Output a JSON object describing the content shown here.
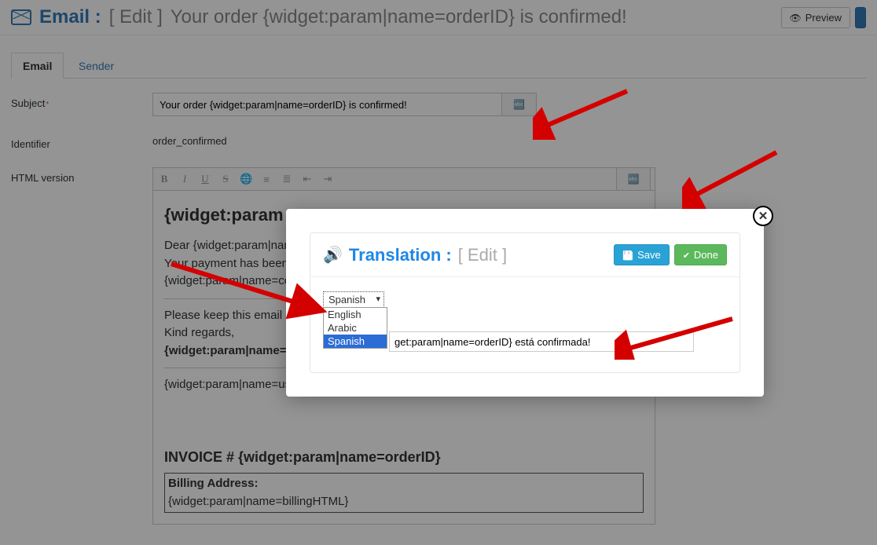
{
  "header": {
    "title_label": "Email :",
    "edit_label": "[ Edit ]",
    "title_rest": "Your order {widget:param|name=orderID} is confirmed!",
    "preview_label": "Preview"
  },
  "tabs": {
    "email": "Email",
    "sender": "Sender"
  },
  "form": {
    "subject_label": "Subject",
    "subject_value": "Your order {widget:param|name=orderID} is confirmed!",
    "identifier_label": "Identifier",
    "identifier_value": "order_confirmed",
    "html_label": "HTML version"
  },
  "editor": {
    "heading": "{widget:param",
    "line1": "Dear {widget:param|nam",
    "line2": "Your payment has been ",
    "line3": "{widget:param|name=co",
    "line4": "Please keep this email as",
    "line5": "Kind regards,",
    "line6": "{widget:param|name=ve",
    "line7": "{widget:param|name=user",
    "invoice": "INVOICE # {widget:param|name=orderID}",
    "billing_label": "Billing Address:",
    "billing_value": "{widget:param|name=billingHTML}"
  },
  "modal": {
    "title": "Translation :",
    "sub": "[ Edit ]",
    "save": "Save",
    "done": "Done",
    "selected_lang": "Spanish",
    "options": [
      "English",
      "Arabic",
      "Spanish"
    ],
    "translated_value": "get:param|name=orderID} está confirmada!"
  }
}
